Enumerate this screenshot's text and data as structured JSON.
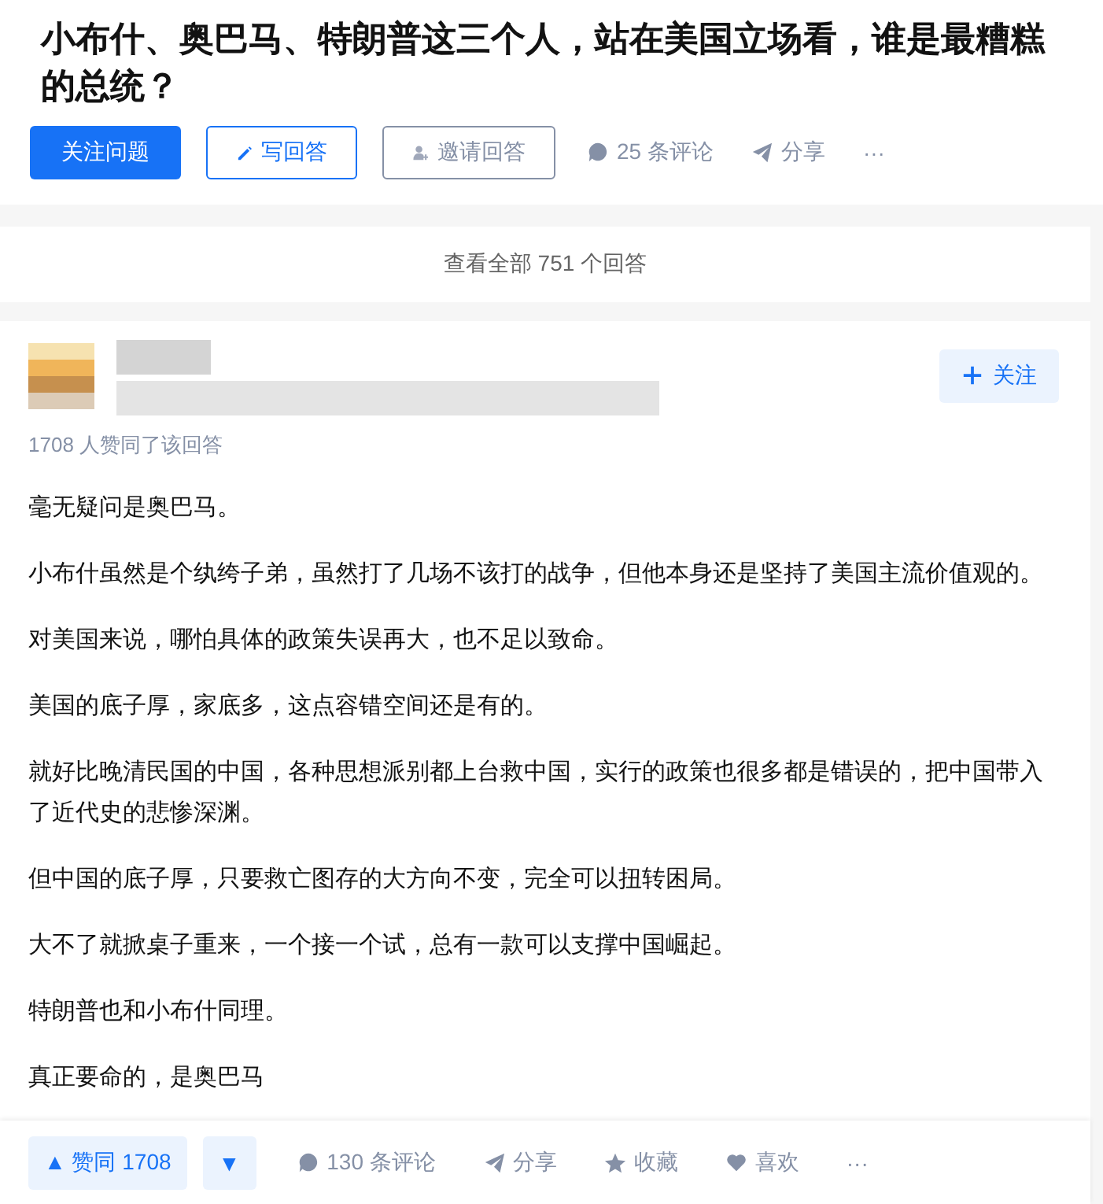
{
  "question": {
    "title": "小布什、奥巴马、特朗普这三个人，站在美国立场看，谁是最糟糕的总统？",
    "actions": [
      {
        "kind": "primary",
        "label": "关注问题"
      },
      {
        "kind": "write",
        "label": "写回答"
      },
      {
        "kind": "invite",
        "label": "邀请回答"
      },
      {
        "kind": "comment",
        "label": "25 条评论"
      },
      {
        "kind": "share",
        "label": "分享"
      },
      {
        "kind": "more",
        "label": "···"
      }
    ]
  },
  "view_all": "查看全部 751 个回答",
  "answer": {
    "follow_button": "关注",
    "upvote_note": "1708 人赞同了该回答",
    "paragraphs": [
      "毫无疑问是奥巴马。",
      "小布什虽然是个纨绔子弟，虽然打了几场不该打的战争，但他本身还是坚持了美国主流价值观的。",
      "对美国来说，哪怕具体的政策失误再大，也不足以致命。",
      "美国的底子厚，家底多，这点容错空间还是有的。",
      "就好比晚清民国的中国，各种思想派别都上台救中国，实行的政策也很多都是错误的，把中国带入了近代史的悲惨深渊。",
      "但中国的底子厚，只要救亡图存的大方向不变，完全可以扭转困局。",
      "大不了就掀桌子重来，一个接一个试，总有一款可以支撑中国崛起。",
      "特朗普也和小布什同理。",
      "真正要命的，是奥巴马"
    ],
    "actions": [
      {
        "kind": "upvote",
        "label": "▲ 赞同 1708"
      },
      {
        "kind": "downvote",
        "label": "▼"
      },
      {
        "kind": "comment",
        "label": "130 条评论"
      },
      {
        "kind": "share",
        "label": "分享"
      },
      {
        "kind": "favorite",
        "label": "收藏"
      },
      {
        "kind": "like",
        "label": "喜欢"
      },
      {
        "kind": "more",
        "label": "···"
      }
    ]
  }
}
